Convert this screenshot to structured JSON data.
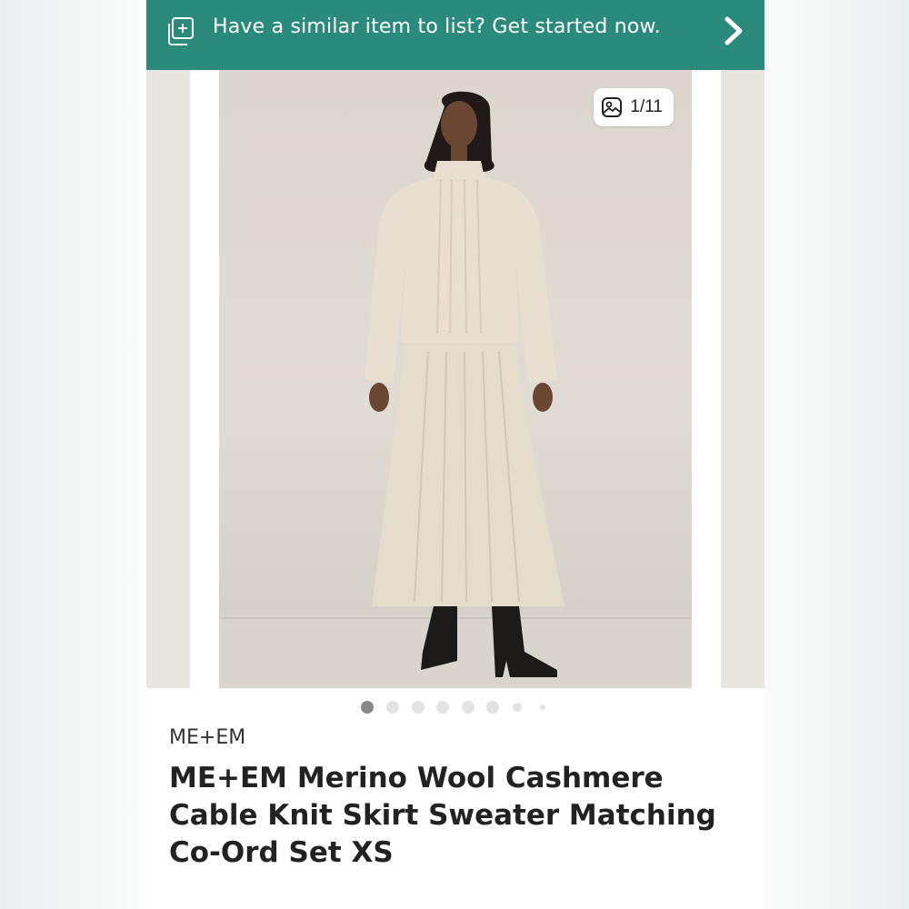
{
  "banner": {
    "text": "Have a similar item to list? Get started now.",
    "icon": "add-listing-icon",
    "chevron": "chevron-right-icon",
    "color": "#2a8b7c"
  },
  "gallery": {
    "counter": "1/11",
    "counter_icon": "image-icon",
    "dots_total": 8,
    "dots_active_index": 0
  },
  "listing": {
    "brand": "ME+EM",
    "title": "ME+EM Merino Wool Cashmere Cable Knit Skirt Sweater Matching Co-Ord Set XS"
  }
}
